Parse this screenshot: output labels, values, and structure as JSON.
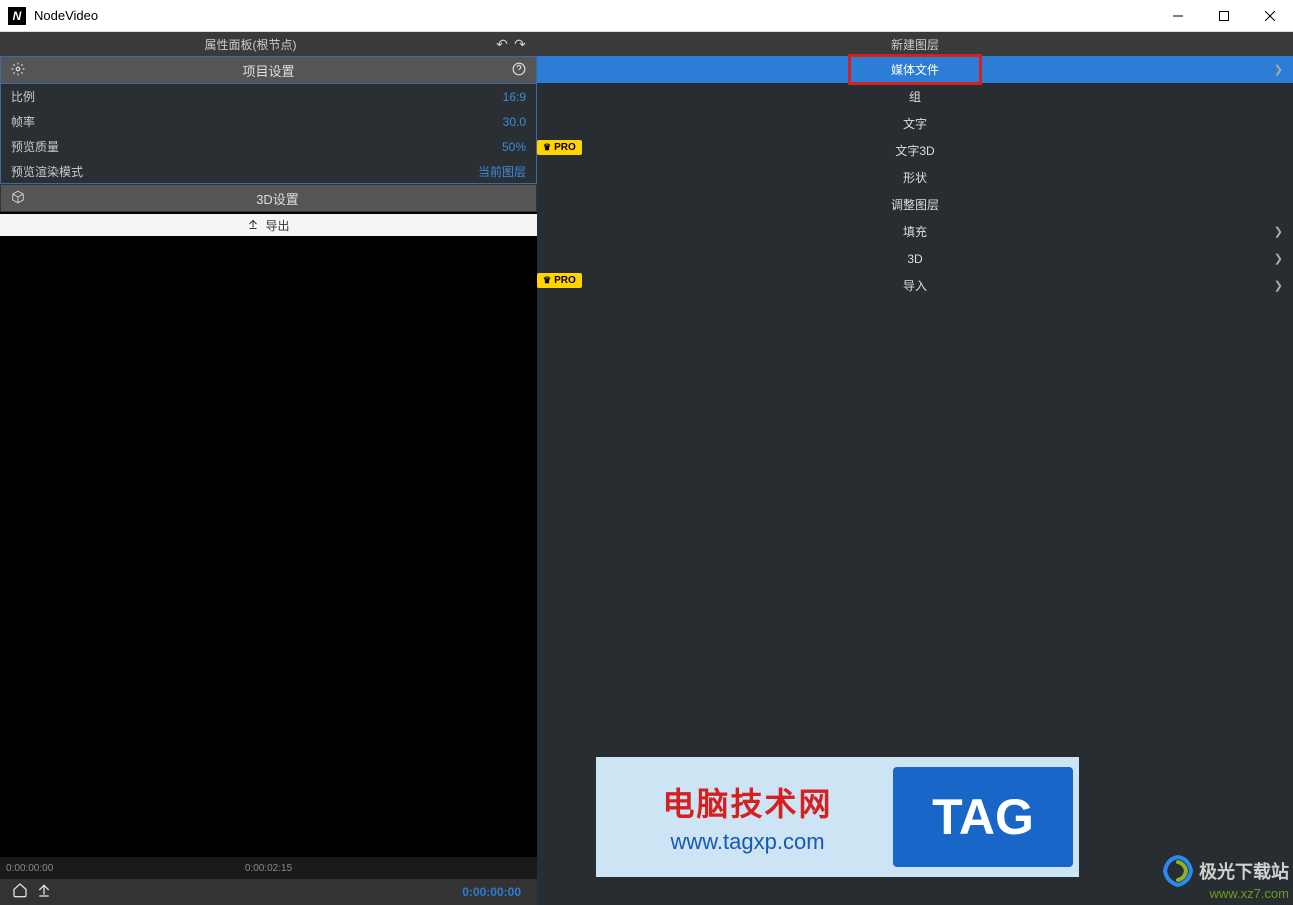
{
  "titlebar": {
    "appName": "NodeVideo"
  },
  "leftPanel": {
    "headerTitle": "属性面板(根节点)",
    "projectSettings": "项目设置",
    "props": [
      {
        "label": "比例",
        "value": "16:9"
      },
      {
        "label": "帧率",
        "value": "30.0"
      },
      {
        "label": "预览质量",
        "value": "50%"
      },
      {
        "label": "预览渲染模式",
        "value": "当前图层"
      }
    ],
    "d3Settings": "3D设置",
    "export": "导出"
  },
  "timeline": {
    "start": "0:00:00:00",
    "mid": "0:00:02:15"
  },
  "bottombar": {
    "time": "0:00:00:00"
  },
  "rightPanel": {
    "header": "新建图层",
    "items": [
      {
        "label": "媒体文件",
        "selected": true,
        "highlighted": true,
        "chevron": true
      },
      {
        "label": "组"
      },
      {
        "label": "文字"
      },
      {
        "label": "文字3D"
      },
      {
        "label": "形状"
      },
      {
        "label": "调整图层"
      },
      {
        "label": "填充",
        "chevron": true
      },
      {
        "label": "3D",
        "chevron": true
      },
      {
        "label": "导入",
        "chevron": true
      }
    ]
  },
  "proBadge": "PRO",
  "watermark1": {
    "cn": "电脑技术网",
    "url": "www.tagxp.com",
    "tag": "TAG"
  },
  "watermark2": {
    "name": "极光下载站",
    "url": "www.xz7.com"
  }
}
